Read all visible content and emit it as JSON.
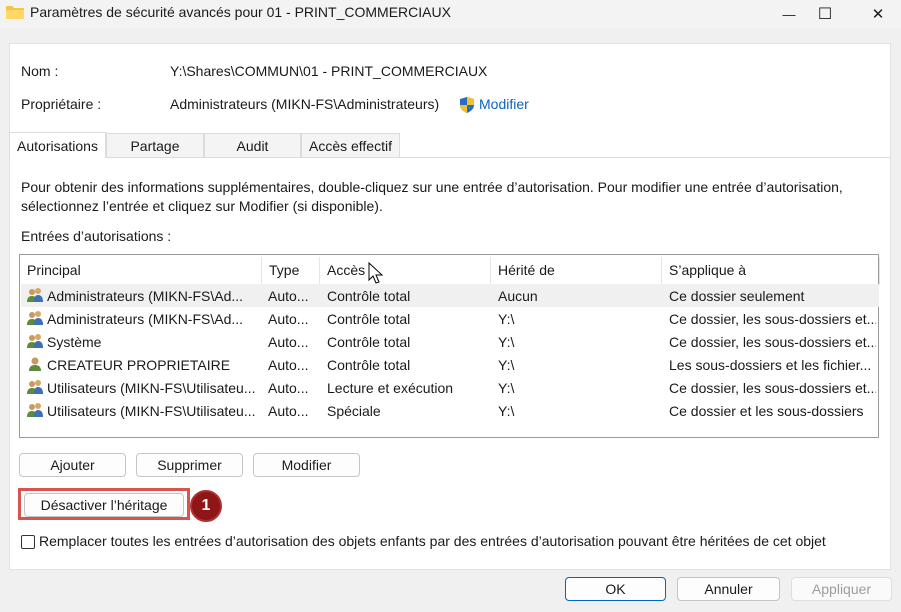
{
  "window": {
    "title": "Paramètres de sécurité avancés pour 01 - PRINT_COMMERCIAUX",
    "minimize_glyph": "—",
    "maximize_glyph": "☐",
    "close_glyph": "✕"
  },
  "info": {
    "name_label": "Nom :",
    "name_value": "Y:\\Shares\\COMMUN\\01 - PRINT_COMMERCIAUX",
    "owner_label": "Propriétaire :",
    "owner_value": "Administrateurs (MIKN-FS\\Administrateurs)",
    "modify_link": "Modifier"
  },
  "tabs": [
    {
      "label": "Autorisations",
      "active": true
    },
    {
      "label": "Partage",
      "active": false
    },
    {
      "label": "Audit",
      "active": false
    },
    {
      "label": "Accès effectif",
      "active": false
    }
  ],
  "description": "Pour obtenir des informations supplémentaires, double-cliquez sur une entrée d’autorisation. Pour modifier une entrée d’autorisation, sélectionnez l’entrée et cliquez sur Modifier (si disponible).",
  "entries_label": "Entrées d’autorisations :",
  "table": {
    "columns": [
      "Principal",
      "Type",
      "Accès",
      "Hérité de",
      "S’applique à"
    ],
    "rows": [
      [
        "Administrateurs (MIKN-FS\\Ad...",
        "Auto...",
        "Contrôle total",
        "Aucun",
        "Ce dossier seulement"
      ],
      [
        "Administrateurs (MIKN-FS\\Ad...",
        "Auto...",
        "Contrôle total",
        "Y:\\",
        "Ce dossier, les sous-dossiers et..."
      ],
      [
        "Système",
        "Auto...",
        "Contrôle total",
        "Y:\\",
        "Ce dossier, les sous-dossiers et..."
      ],
      [
        "CREATEUR PROPRIETAIRE",
        "Auto...",
        "Contrôle total",
        "Y:\\",
        "Les sous-dossiers et les fichier..."
      ],
      [
        "Utilisateurs (MIKN-FS\\Utilisateu...",
        "Auto...",
        "Lecture et exécution",
        "Y:\\",
        "Ce dossier, les sous-dossiers et..."
      ],
      [
        "Utilisateurs (MIKN-FS\\Utilisateu...",
        "Auto...",
        "Spéciale",
        "Y:\\",
        "Ce dossier et les sous-dossiers"
      ]
    ]
  },
  "buttons": {
    "add": "Ajouter",
    "remove": "Supprimer",
    "modify": "Modifier",
    "disable_inheritance": "Désactiver l’héritage",
    "ok": "OK",
    "cancel": "Annuler",
    "apply": "Appliquer"
  },
  "annotation": {
    "number": "1",
    "color": "#d9534f"
  },
  "replace_checkbox": {
    "label": "Remplacer toutes les entrées d’autorisation des objets enfants par des entrées d’autorisation pouvant être héritées de cet objet",
    "checked": false
  },
  "colors": {
    "accent": "#0067c0",
    "link": "#0b63c6",
    "highlight": "#d9534f",
    "badge": "#8e1616"
  }
}
